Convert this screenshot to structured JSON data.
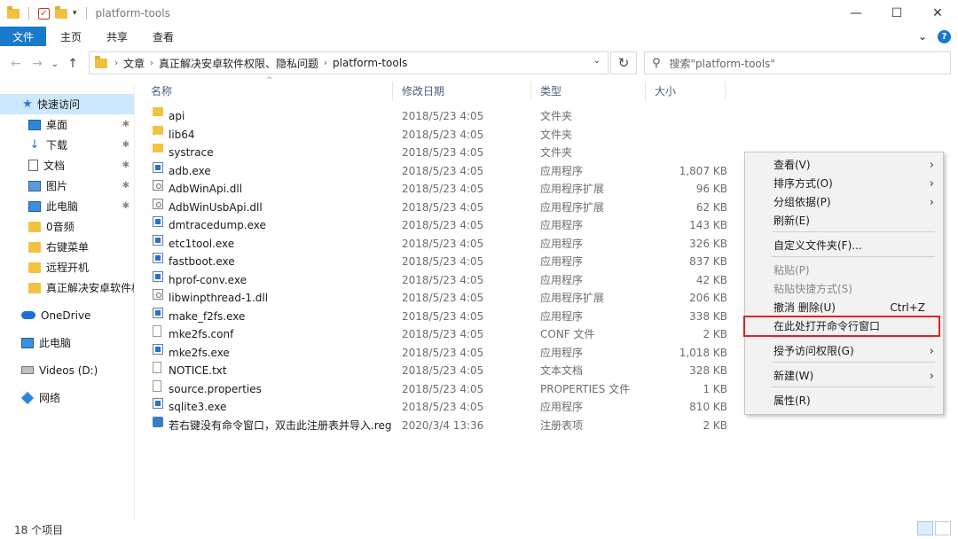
{
  "window": {
    "title": "platform-tools"
  },
  "window_buttons": [
    "—",
    "☐",
    "✕"
  ],
  "ribbon": {
    "tabs": [
      "文件",
      "主页",
      "共享",
      "查看"
    ],
    "expand_glyph": "⌄",
    "help_glyph": "?"
  },
  "nav": {
    "back": "←",
    "forward": "→",
    "recent": "⌄",
    "up": "↑"
  },
  "address": {
    "crumbs": [
      "文章",
      "真正解决安卓软件权限、隐私问题",
      "platform-tools"
    ],
    "refresh": "↻"
  },
  "search": {
    "placeholder": "搜索\"platform-tools\""
  },
  "sidebar": {
    "items": [
      {
        "label": "快速访问",
        "icon": "star-icon"
      },
      {
        "label": "桌面",
        "icon": "desktop-icon",
        "pinned": true
      },
      {
        "label": "下载",
        "icon": "download-icon",
        "pinned": true
      },
      {
        "label": "文档",
        "icon": "document-icon",
        "pinned": true
      },
      {
        "label": "图片",
        "icon": "pictures-icon",
        "pinned": true
      },
      {
        "label": "此电脑",
        "icon": "computer-icon",
        "pinned": true
      },
      {
        "label": "0音频",
        "icon": "folder-icon"
      },
      {
        "label": "右键菜单",
        "icon": "folder-icon"
      },
      {
        "label": "远程开机",
        "icon": "folder-icon"
      },
      {
        "label": "真正解决安卓软件权",
        "icon": "folder-icon"
      },
      {
        "label": "OneDrive",
        "icon": "onedrive-icon"
      },
      {
        "label": "此电脑",
        "icon": "computer-icon"
      },
      {
        "label": "Videos (D:)",
        "icon": "drive-icon"
      },
      {
        "label": "网络",
        "icon": "network-icon"
      }
    ]
  },
  "columns": {
    "name": "名称",
    "date": "修改日期",
    "type": "类型",
    "size": "大小"
  },
  "files": [
    {
      "name": "api",
      "date": "2018/5/23 4:05",
      "type": "文件夹",
      "size": "",
      "icon": "folder"
    },
    {
      "name": "lib64",
      "date": "2018/5/23 4:05",
      "type": "文件夹",
      "size": "",
      "icon": "folder"
    },
    {
      "name": "systrace",
      "date": "2018/5/23 4:05",
      "type": "文件夹",
      "size": "",
      "icon": "folder"
    },
    {
      "name": "adb.exe",
      "date": "2018/5/23 4:05",
      "type": "应用程序",
      "size": "1,807 KB",
      "icon": "exe"
    },
    {
      "name": "AdbWinApi.dll",
      "date": "2018/5/23 4:05",
      "type": "应用程序扩展",
      "size": "96 KB",
      "icon": "dll"
    },
    {
      "name": "AdbWinUsbApi.dll",
      "date": "2018/5/23 4:05",
      "type": "应用程序扩展",
      "size": "62 KB",
      "icon": "dll"
    },
    {
      "name": "dmtracedump.exe",
      "date": "2018/5/23 4:05",
      "type": "应用程序",
      "size": "143 KB",
      "icon": "exe"
    },
    {
      "name": "etc1tool.exe",
      "date": "2018/5/23 4:05",
      "type": "应用程序",
      "size": "326 KB",
      "icon": "exe"
    },
    {
      "name": "fastboot.exe",
      "date": "2018/5/23 4:05",
      "type": "应用程序",
      "size": "837 KB",
      "icon": "exe"
    },
    {
      "name": "hprof-conv.exe",
      "date": "2018/5/23 4:05",
      "type": "应用程序",
      "size": "42 KB",
      "icon": "exe"
    },
    {
      "name": "libwinpthread-1.dll",
      "date": "2018/5/23 4:05",
      "type": "应用程序扩展",
      "size": "206 KB",
      "icon": "dll"
    },
    {
      "name": "make_f2fs.exe",
      "date": "2018/5/23 4:05",
      "type": "应用程序",
      "size": "338 KB",
      "icon": "exe"
    },
    {
      "name": "mke2fs.conf",
      "date": "2018/5/23 4:05",
      "type": "CONF 文件",
      "size": "2 KB",
      "icon": "file"
    },
    {
      "name": "mke2fs.exe",
      "date": "2018/5/23 4:05",
      "type": "应用程序",
      "size": "1,018 KB",
      "icon": "exe"
    },
    {
      "name": "NOTICE.txt",
      "date": "2018/5/23 4:05",
      "type": "文本文档",
      "size": "328 KB",
      "icon": "file"
    },
    {
      "name": "source.properties",
      "date": "2018/5/23 4:05",
      "type": "PROPERTIES 文件",
      "size": "1 KB",
      "icon": "file"
    },
    {
      "name": "sqlite3.exe",
      "date": "2018/5/23 4:05",
      "type": "应用程序",
      "size": "810 KB",
      "icon": "exe"
    },
    {
      "name": "若右键没有命令窗口，双击此注册表并导入.reg",
      "date": "2020/3/4 13:36",
      "type": "注册表项",
      "size": "2 KB",
      "icon": "reg"
    }
  ],
  "context_menu": {
    "items": [
      {
        "label": "查看(V)",
        "submenu": true
      },
      {
        "label": "排序方式(O)",
        "submenu": true
      },
      {
        "label": "分组依据(P)",
        "submenu": true
      },
      {
        "label": "刷新(E)"
      },
      {
        "label": "自定义文件夹(F)..."
      },
      {
        "label": "粘贴(P)",
        "disabled": true
      },
      {
        "label": "粘贴快捷方式(S)",
        "disabled": true
      },
      {
        "label": "撤消 删除(U)",
        "shortcut": "Ctrl+Z"
      },
      {
        "label": "在此处打开命令行窗口",
        "highlighted": true
      },
      {
        "label": "授予访问权限(G)",
        "submenu": true
      },
      {
        "label": "新建(W)",
        "submenu": true
      },
      {
        "label": "属性(R)"
      }
    ],
    "highlight_color": "#e22222"
  },
  "status": {
    "count": "18 个项目"
  },
  "colors": {
    "accent": "#1979ca",
    "selection": "#cce8ff"
  }
}
